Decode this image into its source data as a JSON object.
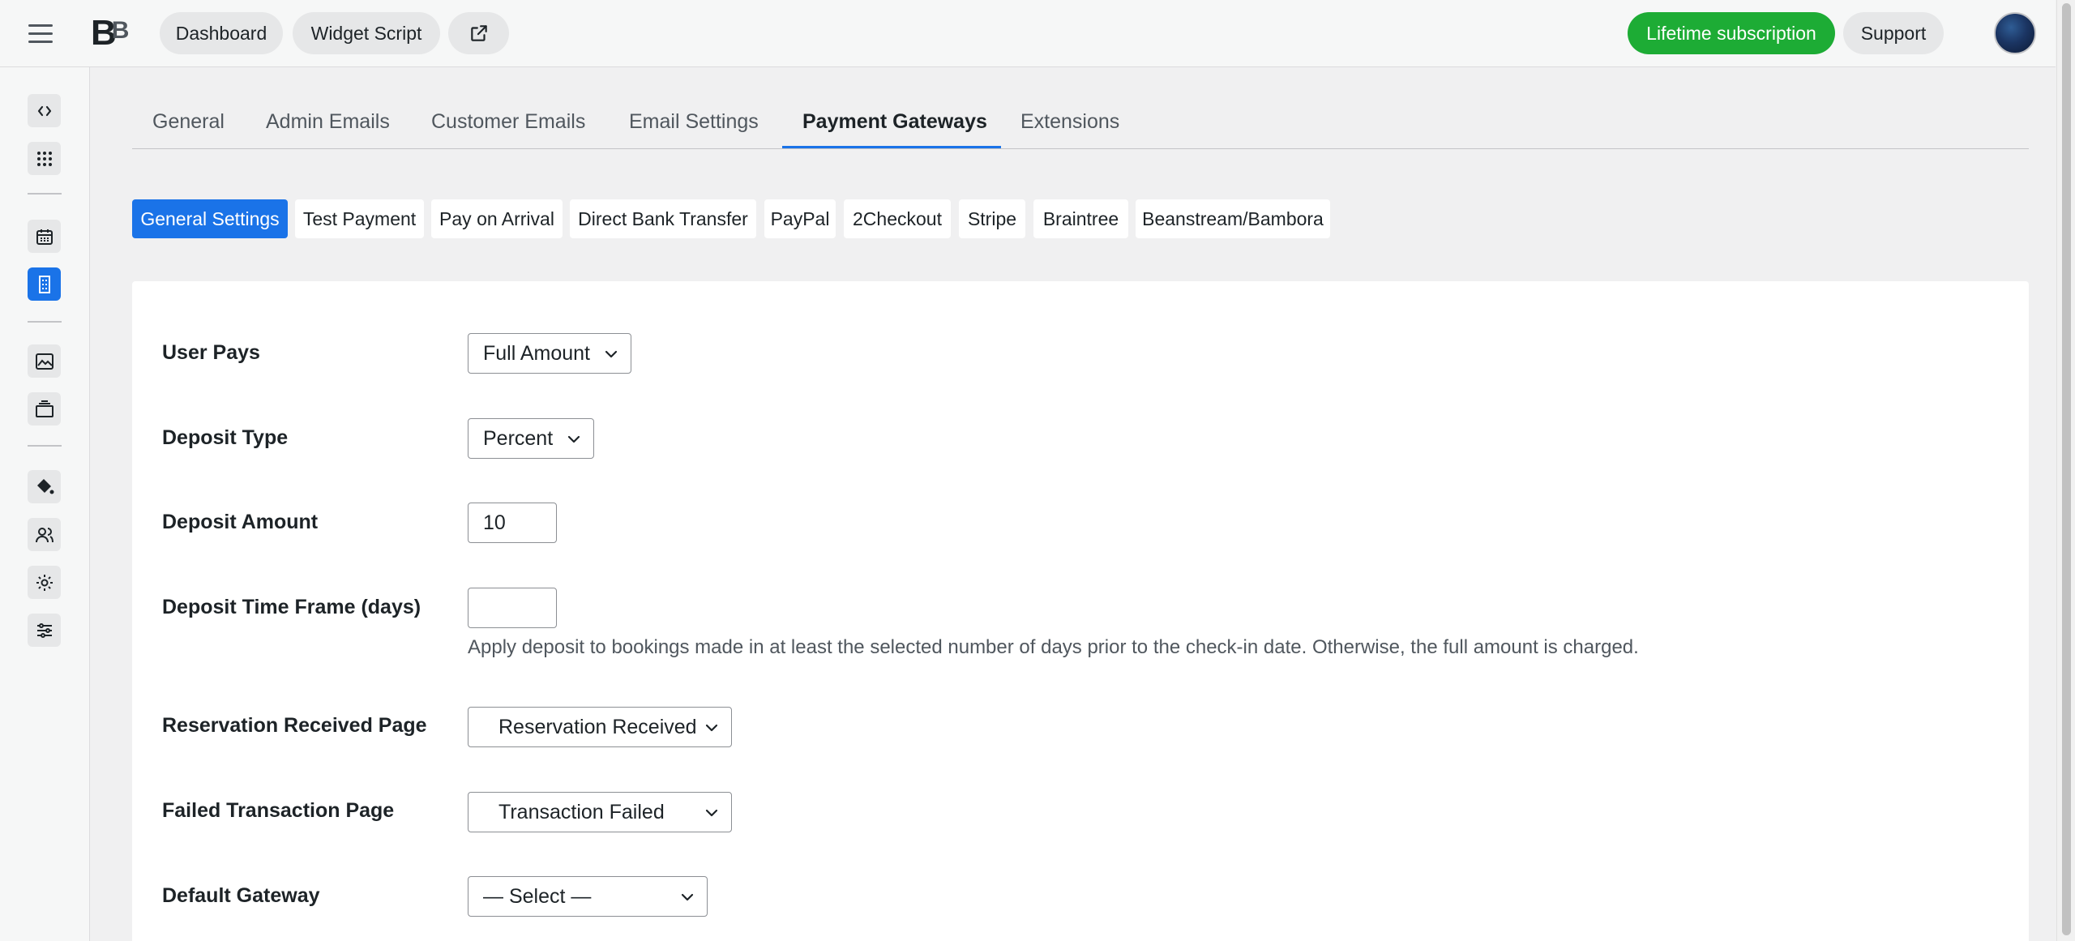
{
  "topbar": {
    "logo_text": "B",
    "logo_text2": "B",
    "dashboard_label": "Dashboard",
    "widget_label": "Widget Script",
    "lifetime_label": "Lifetime subscription",
    "support_label": "Support"
  },
  "colors": {
    "accent": "#1a73e8",
    "success": "#1dac35"
  },
  "sidebar_icons": [
    "code-icon",
    "grid-icon",
    "calendar-icon",
    "building-icon",
    "image-icon",
    "layers-icon",
    "paint-bucket-icon",
    "users-icon",
    "gear-icon",
    "sliders-icon"
  ],
  "tabs": [
    {
      "label": "General"
    },
    {
      "label": "Admin Emails"
    },
    {
      "label": "Customer Emails"
    },
    {
      "label": "Email Settings"
    },
    {
      "label": "Payment Gateways"
    },
    {
      "label": "Extensions"
    }
  ],
  "subtabs": [
    {
      "label": "General Settings"
    },
    {
      "label": "Test Payment"
    },
    {
      "label": "Pay on Arrival"
    },
    {
      "label": "Direct Bank Transfer"
    },
    {
      "label": "PayPal"
    },
    {
      "label": "2Checkout"
    },
    {
      "label": "Stripe"
    },
    {
      "label": "Braintree"
    },
    {
      "label": "Beanstream/Bambora"
    }
  ],
  "form": {
    "user_pays": {
      "label": "User Pays",
      "value": "Full Amount"
    },
    "deposit_type": {
      "label": "Deposit Type",
      "value": "Percent"
    },
    "deposit_amount": {
      "label": "Deposit Amount",
      "value": "10"
    },
    "deposit_time_frame": {
      "label": "Deposit Time Frame (days)",
      "value": "",
      "help": "Apply deposit to bookings made in at least the selected number of days prior to the check-in date. Otherwise, the full amount is charged."
    },
    "reservation_received_page": {
      "label": "Reservation Received Page",
      "value": "Reservation Received"
    },
    "failed_transaction_page": {
      "label": "Failed Transaction Page",
      "value": "Transaction Failed"
    },
    "default_gateway": {
      "label": "Default Gateway",
      "value": "— Select —"
    }
  }
}
